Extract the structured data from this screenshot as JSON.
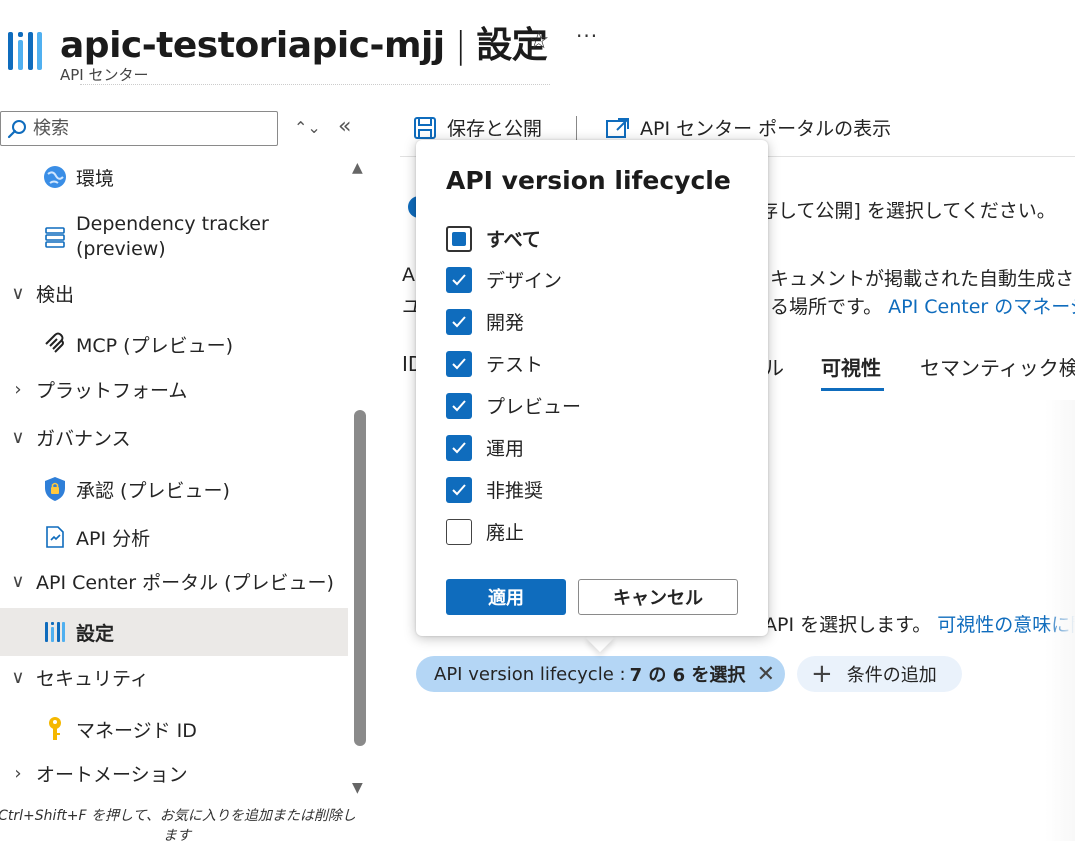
{
  "header": {
    "resource_name": "apic-testoriapic-mjj",
    "separator": "|",
    "page": "設定",
    "subtitle": "API センター",
    "favorite_icon": "star-icon",
    "more_icon": "ellipsis-icon"
  },
  "sidebar": {
    "search_placeholder": "検索",
    "items": [
      {
        "label": "環境",
        "icon": "globe-icon",
        "level": "child"
      },
      {
        "label": "Dependency tracker",
        "label2": "(preview)",
        "icon": "tracker-icon",
        "level": "child"
      },
      {
        "label": "検出",
        "expanded": true,
        "level": "group"
      },
      {
        "label": "MCP (プレビュー)",
        "icon": "mcp-icon",
        "level": "child"
      },
      {
        "label": "プラットフォーム",
        "expanded": false,
        "level": "group"
      },
      {
        "label": "ガバナンス",
        "expanded": true,
        "level": "group"
      },
      {
        "label": "承認 (プレビュー)",
        "icon": "shield-lock-icon",
        "level": "child"
      },
      {
        "label": "API 分析",
        "icon": "analysis-icon",
        "level": "child"
      },
      {
        "label": "API Center ポータル (プレビュー)",
        "expanded": true,
        "level": "group"
      },
      {
        "label": "設定",
        "icon": "api-center-icon",
        "level": "child",
        "selected": true
      },
      {
        "label": "セキュリティ",
        "expanded": true,
        "level": "group"
      },
      {
        "label": "マネージド ID",
        "icon": "key-icon",
        "level": "child"
      },
      {
        "label": "オートメーション",
        "expanded": false,
        "level": "group"
      }
    ],
    "hint": "Ctrl+Shift+F を押して、お気に入りを追加または削除します"
  },
  "toolbar": {
    "save_publish": "保存と公開",
    "view_portal": "API センター ポータルの表示"
  },
  "main": {
    "info_text": "保存して公開] を選択してください。",
    "desc_left1": "AI",
    "desc_left2": "ユ",
    "desc_right1": "キュメントが掲載された自動生成さ",
    "desc_right2": "る場所です。",
    "desc_link": "API Center のマネージ",
    "tabs": [
      "ID",
      "ル",
      "可視性",
      "セマンティック検"
    ],
    "active_tab": "可視性",
    "visibility_text": "API を選択します。",
    "visibility_link": "可視性の意味に関"
  },
  "filter": {
    "active_label": "API version lifecycle :",
    "active_value": "7 の 6 を選択",
    "add_label": "条件の追加"
  },
  "popover": {
    "title": "API version lifecycle",
    "select_all": "すべて",
    "options": [
      {
        "label": "デザイン",
        "checked": true
      },
      {
        "label": "開発",
        "checked": true
      },
      {
        "label": "テスト",
        "checked": true
      },
      {
        "label": "プレビュー",
        "checked": true
      },
      {
        "label": "運用",
        "checked": true
      },
      {
        "label": "非推奨",
        "checked": true
      },
      {
        "label": "廃止",
        "checked": false
      }
    ],
    "apply": "適用",
    "cancel": "キャンセル"
  },
  "colors": {
    "accent": "#0f6cbd",
    "pill_active": "#b4d6f5",
    "selected_row": "#ebe9e7"
  }
}
